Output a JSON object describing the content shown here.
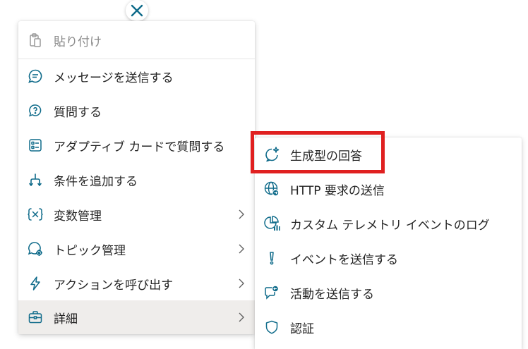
{
  "menu": {
    "items": [
      {
        "label": "貼り付け",
        "icon": "paste-icon",
        "disabled": true,
        "submenu": false
      },
      {
        "label": "メッセージを送信する",
        "icon": "chat-bubble-icon",
        "submenu": false
      },
      {
        "label": "質問する",
        "icon": "question-bubble-icon",
        "submenu": false
      },
      {
        "label": "アダプティブ カードで質問する",
        "icon": "adaptive-card-icon",
        "submenu": false
      },
      {
        "label": "条件を追加する",
        "icon": "branch-icon",
        "submenu": false
      },
      {
        "label": "変数管理",
        "icon": "variable-icon",
        "submenu": true
      },
      {
        "label": "トピック管理",
        "icon": "topic-gear-icon",
        "submenu": true
      },
      {
        "label": "アクションを呼び出す",
        "icon": "lightning-icon",
        "submenu": true
      },
      {
        "label": "詳細",
        "icon": "briefcase-icon",
        "submenu": true,
        "selected": true
      }
    ]
  },
  "submenu": {
    "items": [
      {
        "label": "生成型の回答",
        "icon": "generative-answer-icon",
        "highlighted": true
      },
      {
        "label": "HTTP 要求の送信",
        "icon": "globe-send-icon"
      },
      {
        "label": "カスタム テレメトリ イベントのログ",
        "icon": "telemetry-chart-icon"
      },
      {
        "label": "イベントを送信する",
        "icon": "exclamation-icon"
      },
      {
        "label": "活動を送信する",
        "icon": "activity-send-icon"
      },
      {
        "label": "認証",
        "icon": "shield-icon"
      }
    ]
  },
  "colors": {
    "icon_accent": "#0f6b8a",
    "text": "#242424",
    "disabled_text": "#8a8a8a",
    "selected_bg": "#efedeb",
    "highlight": "#e02020"
  }
}
